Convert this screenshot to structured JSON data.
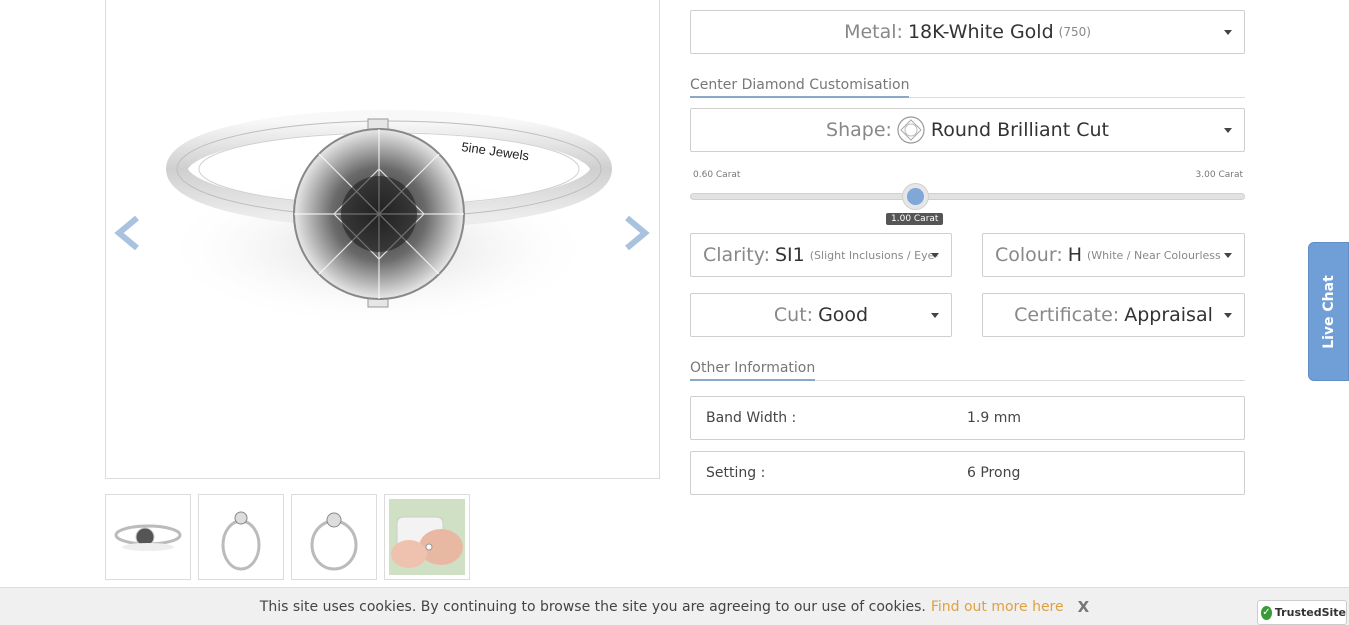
{
  "gallery": {
    "engraving": "5ine Jewels",
    "thumbnails": [
      "ring-top-view",
      "ring-side-view",
      "ring-profile-view",
      "ring-on-hand"
    ]
  },
  "metal": {
    "label": "Metal:",
    "value": "18K-White Gold",
    "sub": "(750)"
  },
  "center_section": {
    "title": "Center Diamond Customisation"
  },
  "shape": {
    "label": "Shape:",
    "value": "Round Brilliant Cut",
    "icon": "round-diamond-icon"
  },
  "carat_slider": {
    "min_label": "0.60 Carat",
    "max_label": "3.00 Carat",
    "current_label": "1.00 Carat",
    "min": 0.6,
    "max": 3.0,
    "value": 1.0
  },
  "clarity": {
    "label": "Clarity:",
    "value": "SI1",
    "sub": "(Slight Inclusions / Eye-"
  },
  "colour": {
    "label": "Colour:",
    "value": "H",
    "sub": "(White / Near Colourless"
  },
  "cut": {
    "label": "Cut:",
    "value": "Good"
  },
  "certificate": {
    "label": "Certificate:",
    "value": "Appraisal"
  },
  "other_section": {
    "title": "Other Information"
  },
  "other_info": [
    {
      "key": "Band Width :",
      "value": "1.9 mm"
    },
    {
      "key": "Setting :",
      "value": "6 Prong"
    }
  ],
  "live_chat": {
    "label": "Live Chat"
  },
  "cookie": {
    "text": "This site uses cookies. By continuing to browse the site you are agreeing to our use of cookies.",
    "link": "Find out more here",
    "close": "X"
  },
  "trusted": {
    "label": "TrustedSite"
  },
  "colors": {
    "accent": "#7fa7d8",
    "arrow": "#a9c2e0",
    "link": "#e0a040",
    "live_chat": "#6f9fd6"
  }
}
